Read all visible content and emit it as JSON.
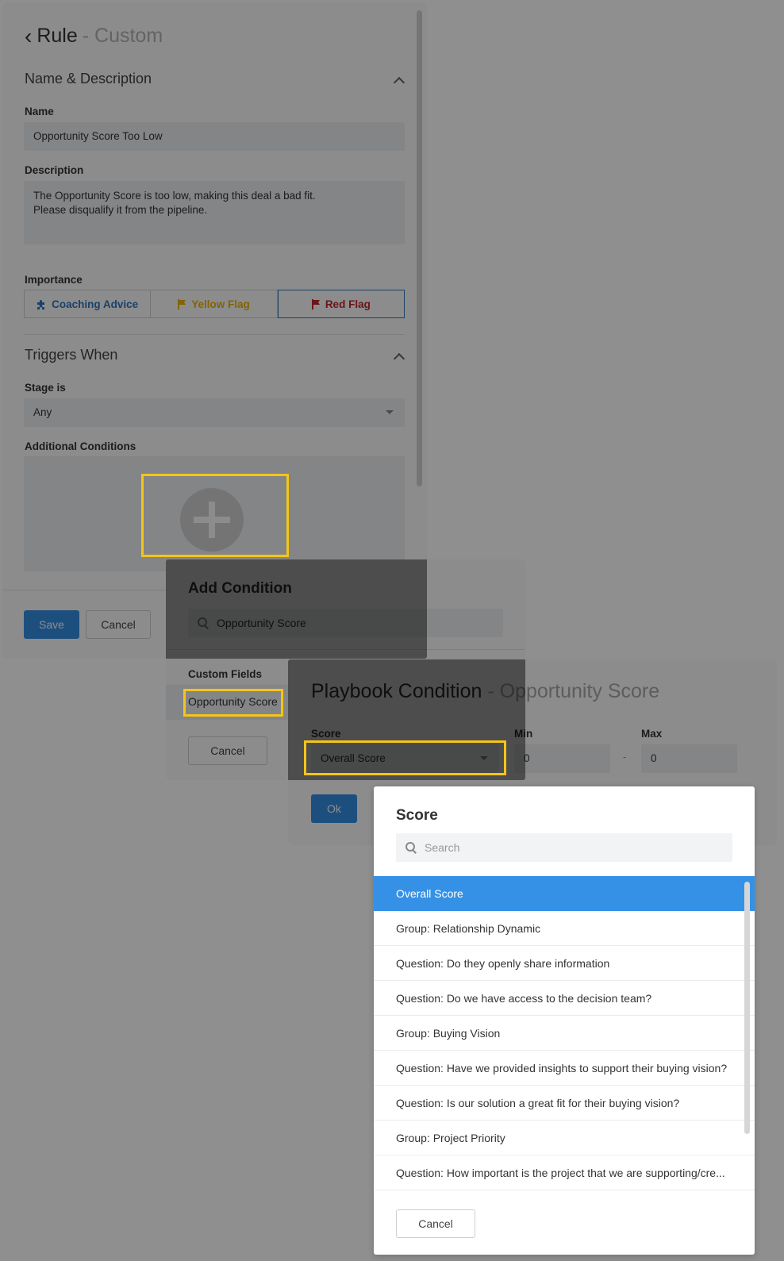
{
  "rule": {
    "back_glyph": "‹",
    "title": "Rule",
    "title_suffix": "- Custom",
    "name_section": "Name & Description",
    "name_label": "Name",
    "name_value": "Opportunity Score Too Low",
    "description_label": "Description",
    "description_value": "The Opportunity Score is too low, making this deal a bad fit.\nPlease disqualify it from the pipeline.",
    "importance_label": "Importance",
    "importance_options": [
      {
        "label": "Coaching Advice",
        "icon": "puzzle-icon",
        "color": "#2f78c4"
      },
      {
        "label": "Yellow Flag",
        "icon": "flag-icon",
        "color": "#f0b400"
      },
      {
        "label": "Red Flag",
        "icon": "flag-icon",
        "color": "#c8262c",
        "selected": true
      }
    ],
    "triggers_section": "Triggers When",
    "stage_label": "Stage is",
    "stage_value": "Any",
    "additional_label": "Additional Conditions",
    "save_label": "Save",
    "cancel_label": "Cancel"
  },
  "add_condition": {
    "title": "Add Condition",
    "search_value": "Opportunity Score",
    "section_label": "Custom Fields",
    "result": "Opportunity Score",
    "cancel_label": "Cancel"
  },
  "playbook": {
    "title": "Playbook Condition",
    "title_suffix": "- Opportunity Score",
    "score_label": "Score",
    "score_value": "Overall Score",
    "min_label": "Min",
    "min_value": "0",
    "range_sep": "-",
    "max_label": "Max",
    "max_value": "0",
    "ok_label": "Ok"
  },
  "score_picker": {
    "title": "Score",
    "search_placeholder": "Search",
    "items": [
      "Overall Score",
      "Group: Relationship Dynamic",
      "Question: Do they openly share information",
      "Question: Do we have access to the decision team?",
      "Group: Buying Vision",
      "Question: Have we provided insights to support their buying vision?",
      "Question: Is our solution a great fit for their buying vision?",
      "Group: Project Priority",
      "Question: How important is the project that we are supporting/cre..."
    ],
    "selected_index": 0,
    "cancel_label": "Cancel"
  },
  "colors": {
    "accent": "#3591e6",
    "highlight": "#f5c518",
    "red_flag": "#c8262c",
    "yellow_flag": "#f0b400"
  }
}
